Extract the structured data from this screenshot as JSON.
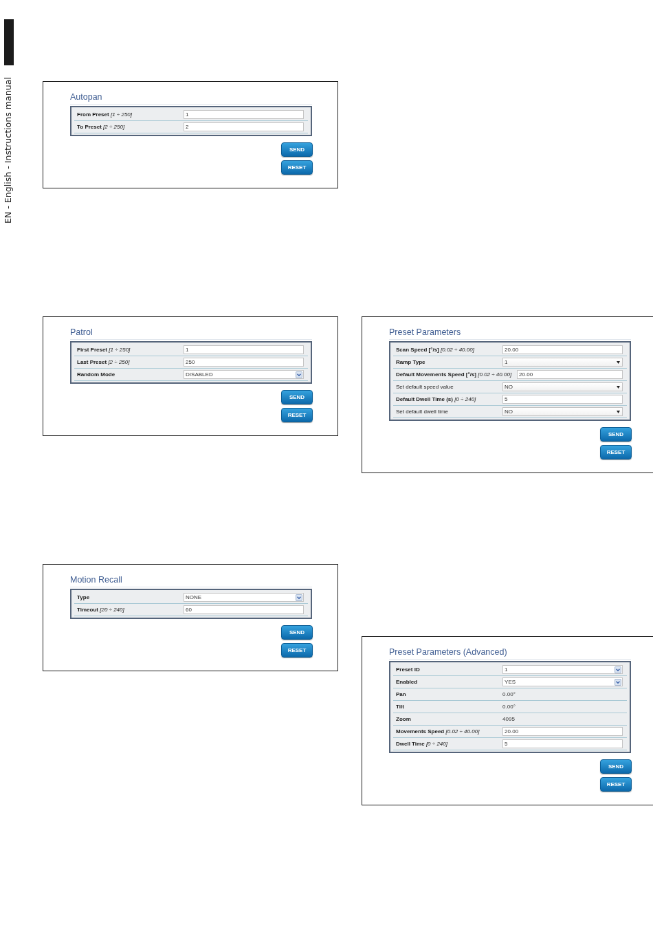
{
  "sidebar": {
    "text": "EN - English - Instructions manual"
  },
  "left_column": {
    "panels": [
      {
        "title": "Autopan",
        "rows": [
          {
            "kind": "input",
            "label": "From Preset",
            "range": "[1 ÷ 250]",
            "bold": true,
            "value": "1"
          },
          {
            "kind": "input",
            "label": "To Preset",
            "range": "[2 ÷ 250]",
            "bold": true,
            "value": "2"
          }
        ],
        "buttons": [
          "SEND",
          "RESET"
        ]
      },
      {
        "title": "Patrol",
        "rows": [
          {
            "kind": "input",
            "label": "First Preset",
            "range": "[1 ÷ 250]",
            "bold": true,
            "value": "1"
          },
          {
            "kind": "input",
            "label": "Last Preset",
            "range": "[2 ÷ 250]",
            "bold": true,
            "value": "250"
          },
          {
            "kind": "select",
            "label": "Random Mode",
            "bold": true,
            "value": "DISABLED"
          }
        ],
        "buttons": [
          "SEND",
          "RESET"
        ]
      },
      {
        "title": "Motion Recall",
        "rows": [
          {
            "kind": "select",
            "label": "Type",
            "bold": true,
            "value": "NONE"
          },
          {
            "kind": "input",
            "label": "Timeout",
            "range": "[20 ÷ 240]",
            "bold": true,
            "value": "60"
          }
        ],
        "buttons": [
          "SEND",
          "RESET"
        ]
      }
    ]
  },
  "right_column": {
    "panels": [
      {
        "title": "Preset Parameters",
        "rows": [
          {
            "kind": "input",
            "label": "Scan Speed [°/s]",
            "range": "[0.02 ÷ 40.00]",
            "bold": true,
            "value": "20.00"
          },
          {
            "kind": "dropdown",
            "label": "Ramp Type",
            "bold": true,
            "value": "1"
          },
          {
            "kind": "input",
            "label": "Default Movements Speed [°/s]",
            "range": "[0.02 ÷ 40.00]",
            "bold": true,
            "value": "20.00"
          },
          {
            "kind": "dropdown",
            "label": "Set default speed value",
            "bold": false,
            "value": "NO"
          },
          {
            "kind": "input",
            "label": "Default Dwell Time (s)",
            "range": "[0 ÷ 240]",
            "bold": true,
            "value": "5"
          },
          {
            "kind": "dropdown",
            "label": "Set default dwell time",
            "bold": false,
            "value": "NO"
          }
        ],
        "buttons": [
          "SEND",
          "RESET"
        ]
      },
      {
        "title": "Preset Parameters (Advanced)",
        "rows": [
          {
            "kind": "select",
            "label": "Preset ID",
            "bold": true,
            "value": "1"
          },
          {
            "kind": "select",
            "label": "Enabled",
            "bold": true,
            "value": "YES"
          },
          {
            "kind": "text",
            "label": "Pan",
            "bold": true,
            "value": "0.00°"
          },
          {
            "kind": "text",
            "label": "Tilt",
            "bold": true,
            "value": "0.00°"
          },
          {
            "kind": "text",
            "label": "Zoom",
            "bold": true,
            "value": "4095"
          },
          {
            "kind": "input",
            "label": "Movements Speed",
            "range": "[0.02 ÷ 40.00]",
            "bold": true,
            "value": "20.00"
          },
          {
            "kind": "input",
            "label": "Dwell Time",
            "range": "[0 ÷ 240]",
            "bold": true,
            "value": "5"
          }
        ],
        "buttons": [
          "SEND",
          "RESET"
        ]
      }
    ]
  }
}
